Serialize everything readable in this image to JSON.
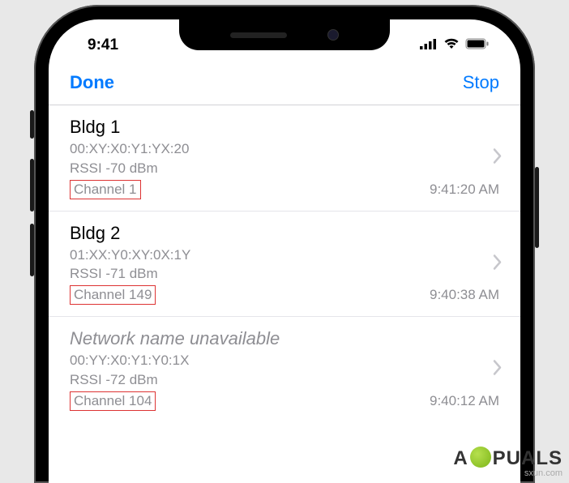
{
  "status": {
    "time": "9:41"
  },
  "nav": {
    "done_label": "Done",
    "stop_label": "Stop"
  },
  "networks": [
    {
      "name": "Bldg 1",
      "unavailable": false,
      "bssid": "00:XY:X0:Y1:YX:20",
      "rssi": "RSSI -70 dBm",
      "channel": "Channel 1",
      "time": "9:41:20 AM"
    },
    {
      "name": "Bldg 2",
      "unavailable": false,
      "bssid": "01:XX:Y0:XY:0X:1Y",
      "rssi": "RSSI -71 dBm",
      "channel": "Channel 149",
      "time": "9:40:38 AM"
    },
    {
      "name": "Network name unavailable",
      "unavailable": true,
      "bssid": "00:YY:X0:Y1:Y0:1X",
      "rssi": "RSSI -72 dBm",
      "channel": "Channel 104",
      "time": "9:40:12 AM"
    }
  ],
  "watermark": {
    "brand_pre": "A",
    "brand_post": "PUALS",
    "sub": "sxun.com"
  }
}
